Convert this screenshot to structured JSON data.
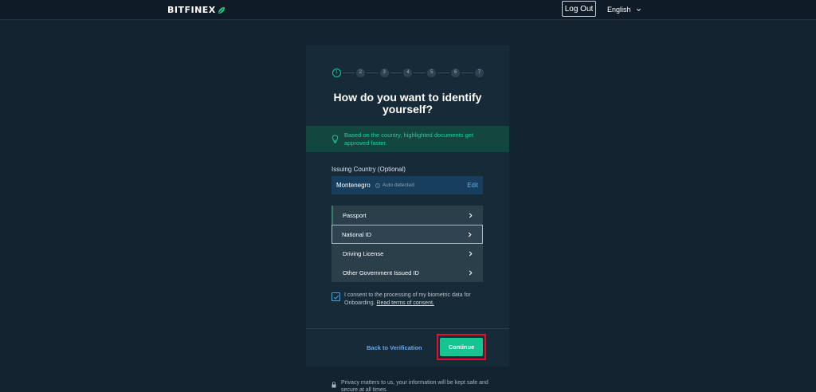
{
  "header": {
    "logo_text": "BITFINEX",
    "logout_label": "Log Out",
    "language": "English"
  },
  "stepper": {
    "steps": [
      "1",
      "2",
      "3",
      "4",
      "5",
      "6",
      "7"
    ],
    "current": 1
  },
  "main": {
    "title_line1": "How do you want to identify",
    "title_line2": "yourself?",
    "info_text": "Based on the country, highlighted documents get approved faster.",
    "country_label": "Issuing Country (Optional)",
    "country_name": "Montenegro",
    "auto_detected": "Auto detected",
    "edit_label": "Edit",
    "documents": [
      {
        "label": "Passport",
        "state": "highlighted"
      },
      {
        "label": "National ID",
        "state": "selected"
      },
      {
        "label": "Driving License",
        "state": "normal"
      },
      {
        "label": "Other Government Issued ID",
        "state": "normal"
      }
    ],
    "consent_text": "I consent to the processing of my biometric data for Onboarding.",
    "consent_link": "Read terms of consent.",
    "consent_checked": true,
    "back_label": "Back to Verification",
    "continue_label": "Continue"
  },
  "footer": {
    "privacy_text": "Privacy matters to us, your information will be kept safe and secure at all times."
  },
  "colors": {
    "background": "#13232f",
    "card": "#172a38",
    "accent_green": "#15c591",
    "link_blue": "#6ba8e6",
    "highlight_red": "#e0102e"
  }
}
